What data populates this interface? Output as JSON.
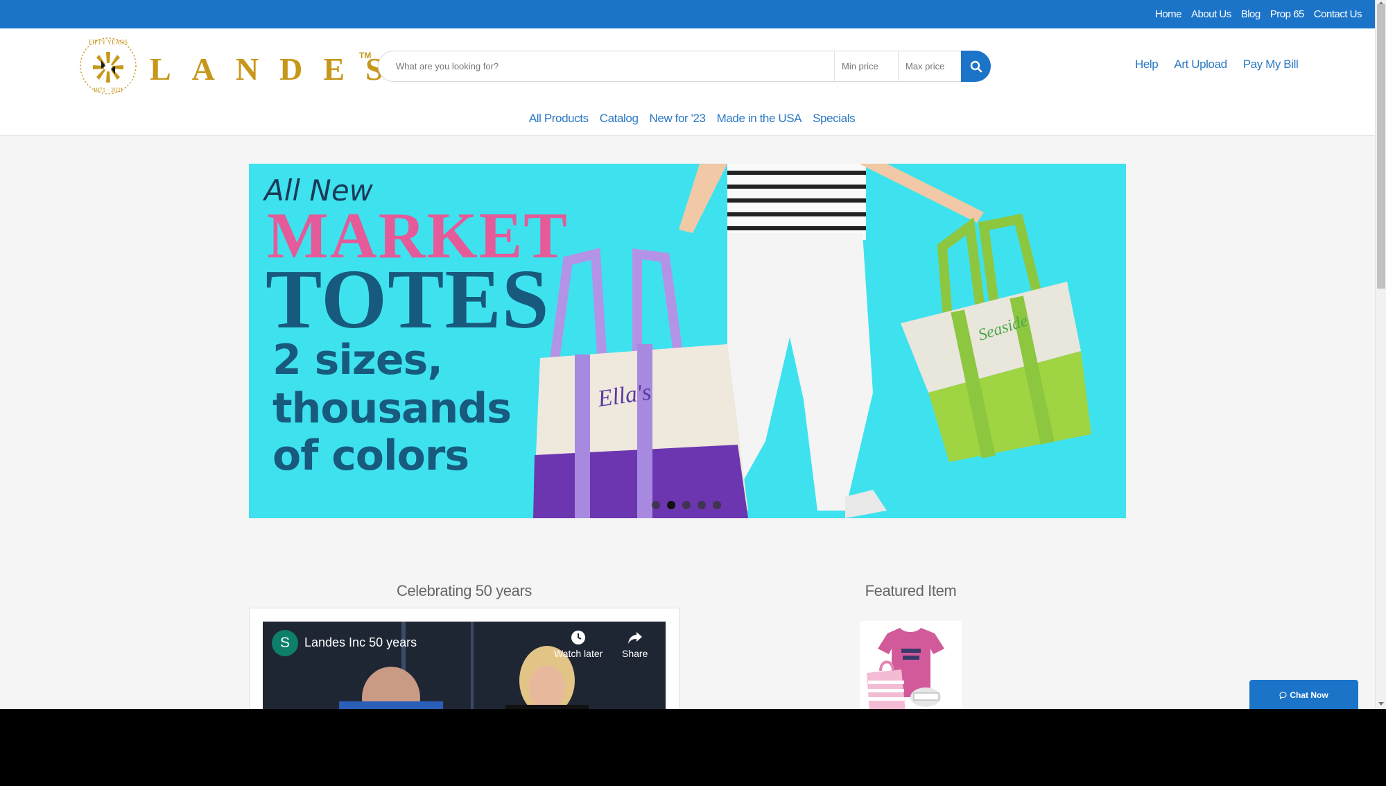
{
  "topbar": {
    "links": [
      "Home",
      "About Us",
      "Blog",
      "Prop 65",
      "Contact Us"
    ]
  },
  "logo": {
    "text": "LANDES",
    "tm": "TM",
    "seal_text": "FIFTY YEARS 1971-2021"
  },
  "search": {
    "placeholder": "What are you looking for?",
    "min_price_placeholder": "Min price",
    "max_price_placeholder": "Max price"
  },
  "header_links": [
    "Help",
    "Art Upload",
    "Pay My Bill"
  ],
  "main_nav": [
    "All Products",
    "Catalog",
    "New for '23",
    "Made in the USA",
    "Specials"
  ],
  "hero": {
    "all_new": "All New",
    "market": "MARKET",
    "totes": "TOTES",
    "line1": "2 sizes,",
    "line2": "thousands",
    "line3": "of colors",
    "bag1_logo": "Ella's",
    "bag2_logo": "Seaside",
    "slides": 5,
    "active_slide": 2
  },
  "sections": {
    "left_title": "Celebrating 50 years",
    "right_title": "Featured Item"
  },
  "video": {
    "avatar_letter": "S",
    "title": "Landes Inc 50 years",
    "watch_later": "Watch later",
    "share": "Share"
  },
  "chat": {
    "label": "Chat Now"
  },
  "colors": {
    "brand_blue": "#1b74c8",
    "gold": "#c6971a",
    "hero_bg": "#3ee2ee",
    "market_pink": "#e55a98",
    "totes_navy": "#175a7e"
  }
}
